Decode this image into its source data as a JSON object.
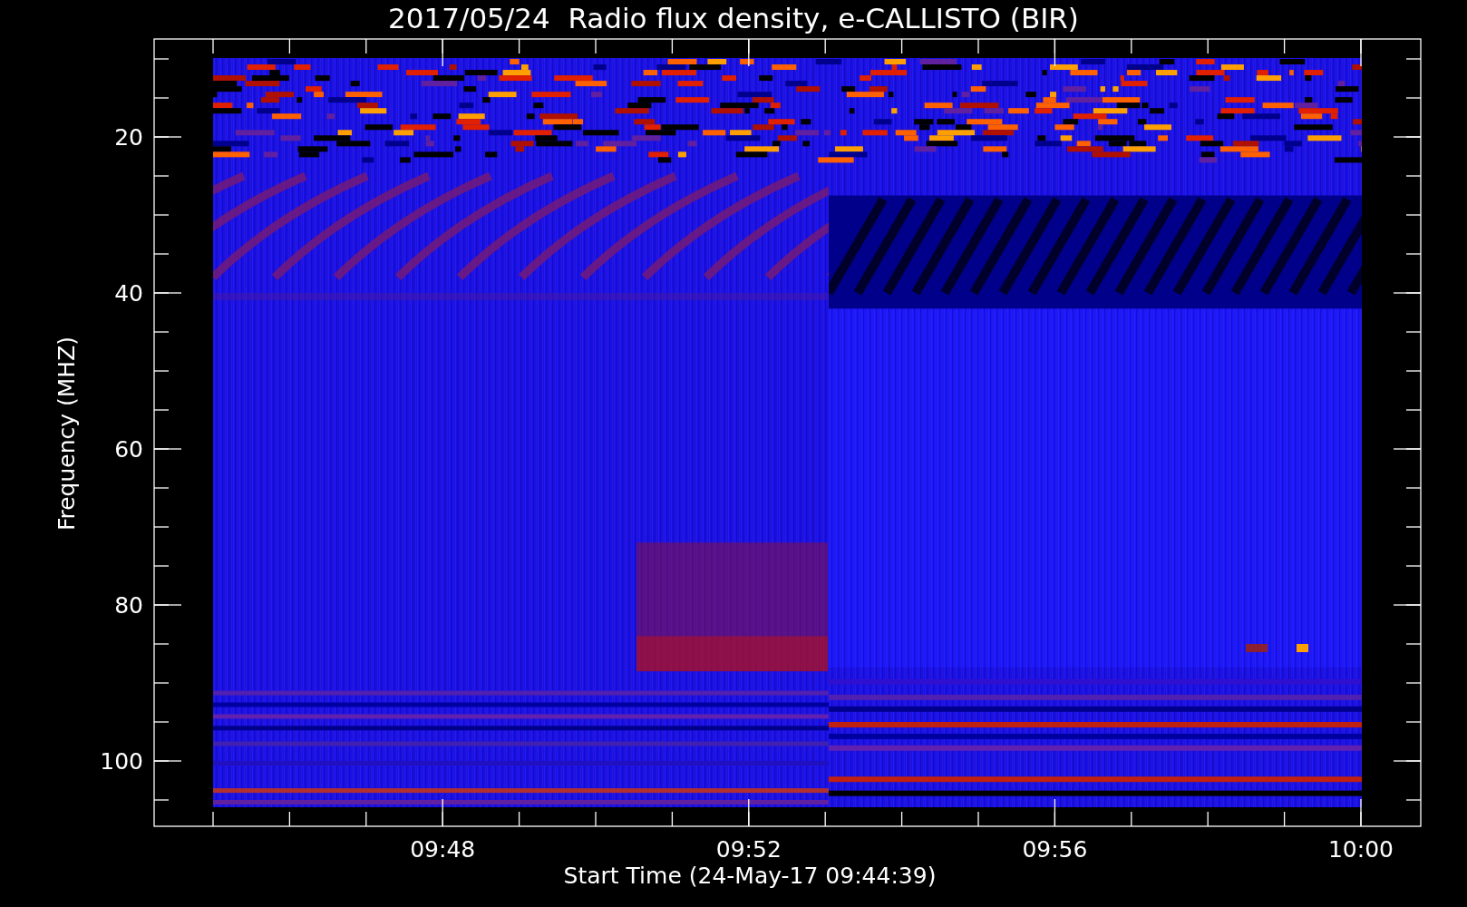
{
  "title": "2017/05/24  Radio flux density, e-CALLISTO (BIR)",
  "y_axis": {
    "label": "Frequency (MHZ)",
    "ticks": [
      "20",
      "40",
      "60",
      "80",
      "100"
    ]
  },
  "x_axis": {
    "label": "Start Time (24-May-17 09:44:39)",
    "ticks": [
      "09:48",
      "09:52",
      "09:56",
      "10:00"
    ]
  }
}
